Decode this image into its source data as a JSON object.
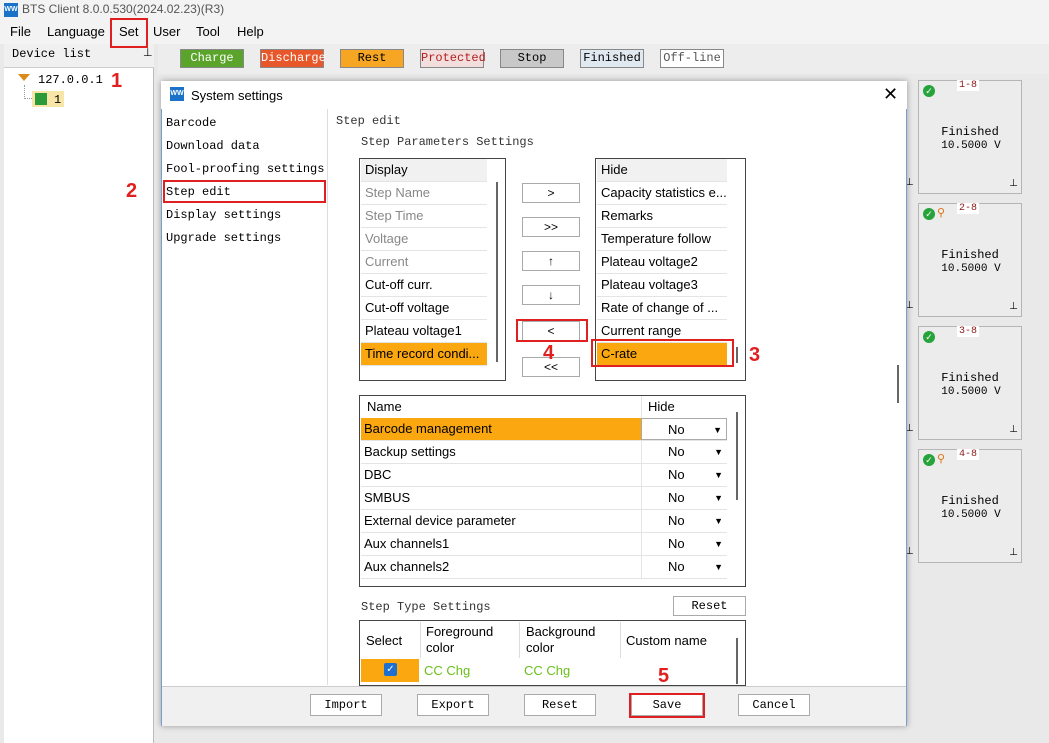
{
  "window": {
    "title": "BTS Client 8.0.0.530(2024.02.23)(R3)"
  },
  "menubar": [
    "File",
    "Language",
    "Set",
    "User",
    "Tool",
    "Help"
  ],
  "device_panel": {
    "header": "Device list",
    "root": "127.0.0.1",
    "child": "1"
  },
  "status_buttons": [
    {
      "label": "Charge",
      "color": "#5aa42b"
    },
    {
      "label": "Discharge",
      "color": "#e8572a"
    },
    {
      "label": "Rest",
      "color": "#f6a623"
    },
    {
      "label": "Protected",
      "color": "#f3dede"
    },
    {
      "label": "Stop",
      "color": "#c8c8c8"
    },
    {
      "label": "Finished",
      "color": "#e0e8f0"
    },
    {
      "label": "Off-line",
      "color": "#ffffff"
    }
  ],
  "channels": [
    {
      "num": "1-8",
      "status": "Finished",
      "voltage": "10.5000 V"
    },
    {
      "num": "2-8",
      "status": "Finished",
      "voltage": "10.5000 V"
    },
    {
      "num": "3-8",
      "status": "Finished",
      "voltage": "10.5000 V"
    },
    {
      "num": "4-8",
      "status": "Finished",
      "voltage": "10.5000 V"
    }
  ],
  "dialog": {
    "title": "System settings",
    "close_icon": "close-icon",
    "nav": [
      "Barcode",
      "Download data",
      "Fool-proofing settings",
      "Step edit",
      "Display settings",
      "Upgrade settings"
    ],
    "section_title": "Step edit",
    "step_params_title": "Step Parameters Settings",
    "display_list": {
      "header": "Display",
      "items": [
        "Step Name",
        "Step Time",
        "Voltage",
        "Current",
        "Cut-off curr.",
        "Cut-off voltage",
        "Plateau voltage1",
        "Time record condi..."
      ]
    },
    "hide_list": {
      "header": "Hide",
      "items": [
        "Capacity statistics e...",
        "Remarks",
        "Temperature follow",
        "Plateau voltage2",
        "Plateau voltage3",
        "Rate of change of ...",
        "Current range",
        "C-rate"
      ]
    },
    "arrow_buttons": [
      ">",
      ">>",
      "↑",
      "↓",
      "<",
      "<<"
    ],
    "grid": {
      "headers": [
        "Name",
        "Hide"
      ],
      "rows": [
        {
          "name": "Barcode management",
          "value": "No"
        },
        {
          "name": "Backup settings",
          "value": "No"
        },
        {
          "name": "DBC",
          "value": "No"
        },
        {
          "name": "SMBUS",
          "value": "No"
        },
        {
          "name": "External device parameter",
          "value": "No"
        },
        {
          "name": "Aux channels1",
          "value": "No"
        },
        {
          "name": "Aux channels2",
          "value": "No"
        }
      ]
    },
    "step_type_title": "Step Type Settings",
    "step_type_reset": "Reset",
    "step_type_table": {
      "headers": [
        "Select",
        "Foreground color",
        "Background color",
        "Custom name"
      ],
      "row": {
        "foreground": "CC Chg",
        "background": "CC Chg"
      }
    },
    "footer_buttons": [
      "Import",
      "Export",
      "Reset",
      "Save",
      "Cancel"
    ]
  },
  "annotations": [
    "1",
    "2",
    "3",
    "4",
    "5"
  ],
  "colors": {
    "highlight": "#fba710",
    "annotation": "#e02020",
    "finished_card": "#ececec"
  }
}
